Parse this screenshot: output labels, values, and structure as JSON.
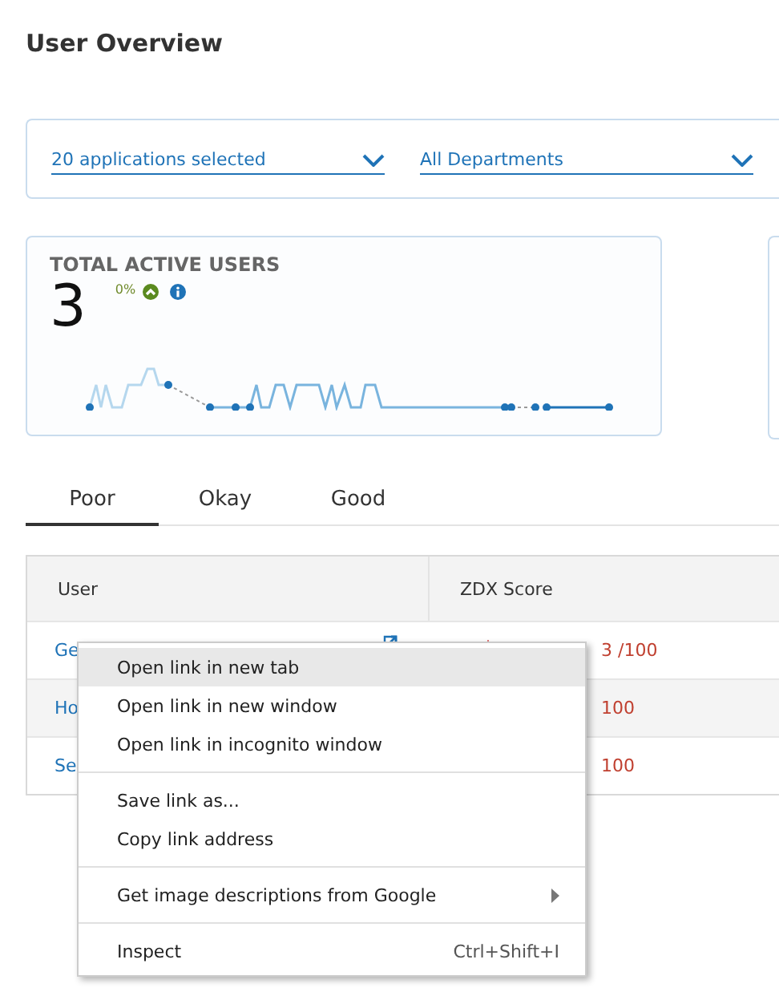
{
  "page": {
    "title": "User Overview"
  },
  "filters": [
    {
      "value": "20 applications selected"
    },
    {
      "value": "All Departments"
    }
  ],
  "card": {
    "title": "TOTAL ACTIVE USERS",
    "value": "3",
    "change": "0%"
  },
  "tabs": [
    {
      "label": "Poor",
      "selected": true
    },
    {
      "label": "Okay",
      "selected": false
    },
    {
      "label": "Good",
      "selected": false
    }
  ],
  "table": {
    "columns": [
      "User",
      "ZDX Score"
    ],
    "rows": [
      {
        "user": "Ge",
        "external_link": true,
        "score": "3 /100"
      },
      {
        "user": "Ho",
        "score": "100",
        "shaded": true
      },
      {
        "user": "Se",
        "score": "100"
      }
    ]
  },
  "context_menu": {
    "groups": [
      [
        {
          "label": "Open link in new tab",
          "selected": true
        },
        {
          "label": "Open link in new window",
          "selected": false
        },
        {
          "label": "Open link in incognito window",
          "selected": false
        }
      ],
      [
        {
          "label": "Save link as...",
          "selected": false
        },
        {
          "label": "Copy link address",
          "selected": false
        }
      ],
      [
        {
          "label": "Get image descriptions from Google",
          "selected": false,
          "submenu": true
        }
      ],
      [
        {
          "label": "Inspect",
          "selected": false,
          "shortcut": "Ctrl+Shift+I"
        }
      ]
    ]
  }
}
